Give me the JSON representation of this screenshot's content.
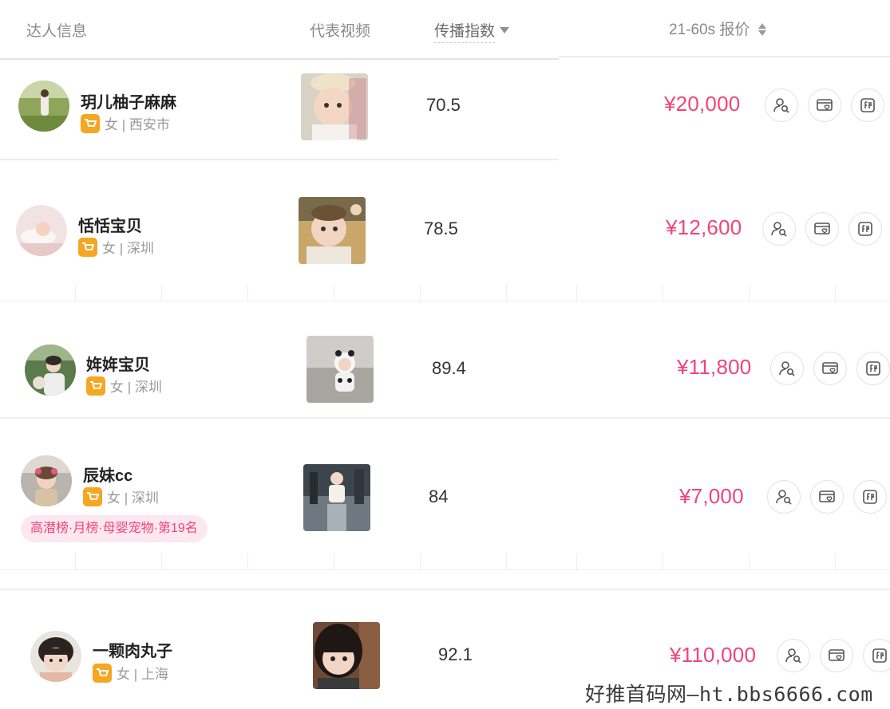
{
  "header": {
    "info_label": "达人信息",
    "video_label": "代表视频",
    "index_label": "传播指数",
    "price_label": "21-60s 报价"
  },
  "rows": [
    {
      "name": "玥儿柚子麻麻",
      "gender_city": "女 | 西安市",
      "index": "70.5",
      "price": "¥20,000",
      "tag": ""
    },
    {
      "name": "恬恬宝贝",
      "gender_city": "女 | 深圳",
      "index": "78.5",
      "price": "¥12,600",
      "tag": ""
    },
    {
      "name": "姩姩宝贝",
      "gender_city": "女 | 深圳",
      "index": "89.4",
      "price": "¥11,800",
      "tag": ""
    },
    {
      "name": "辰妹cc",
      "gender_city": "女 | 深圳",
      "index": "84",
      "price": "¥7,000",
      "tag": "高潜榜·月榜·母婴宠物·第19名"
    },
    {
      "name": "一颗肉丸子",
      "gender_city": "女 | 上海",
      "index": "92.1",
      "price": "¥110,000",
      "tag": ""
    }
  ],
  "icons": {
    "shop": "shopping-cart-icon",
    "action_1": "user-search-icon",
    "action_2": "card-heart-icon",
    "action_3": "compare-icon",
    "sort_desc": "caret-down-icon",
    "sort_both": "sort-icon"
  },
  "colors": {
    "price": "#f0447a",
    "shop_badge": "#f5a623",
    "tag_bg": "#fde8ef"
  },
  "watermark": "好推首码网—ht.bbs6666.com"
}
